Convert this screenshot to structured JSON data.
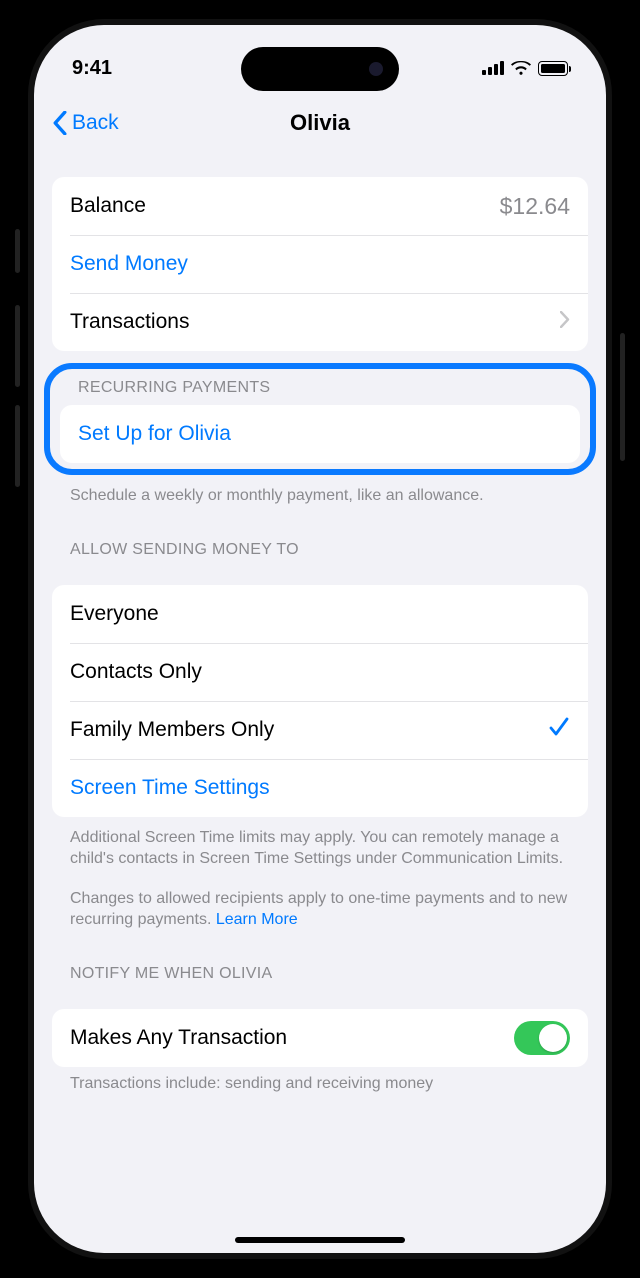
{
  "status": {
    "time": "9:41"
  },
  "nav": {
    "back": "Back",
    "title": "Olivia"
  },
  "balance": {
    "label": "Balance",
    "value": "$12.64",
    "send": "Send Money",
    "transactions": "Transactions"
  },
  "recurring": {
    "header": "RECURRING PAYMENTS",
    "setup": "Set Up for Olivia",
    "footer": "Schedule a weekly or monthly payment, like an allowance."
  },
  "allow": {
    "header": "ALLOW SENDING MONEY TO",
    "options": [
      "Everyone",
      "Contacts Only",
      "Family Members Only"
    ],
    "screentime": "Screen Time Settings",
    "footer1": "Additional Screen Time limits may apply. You can remotely manage a child's contacts in Screen Time Settings under Communication Limits.",
    "footer2": "Changes to allowed recipients apply to one-time payments and to new recurring payments. ",
    "learnmore": "Learn More"
  },
  "notify": {
    "header": "NOTIFY ME WHEN OLIVIA",
    "any": "Makes Any Transaction",
    "footer": "Transactions include: sending and receiving money"
  }
}
